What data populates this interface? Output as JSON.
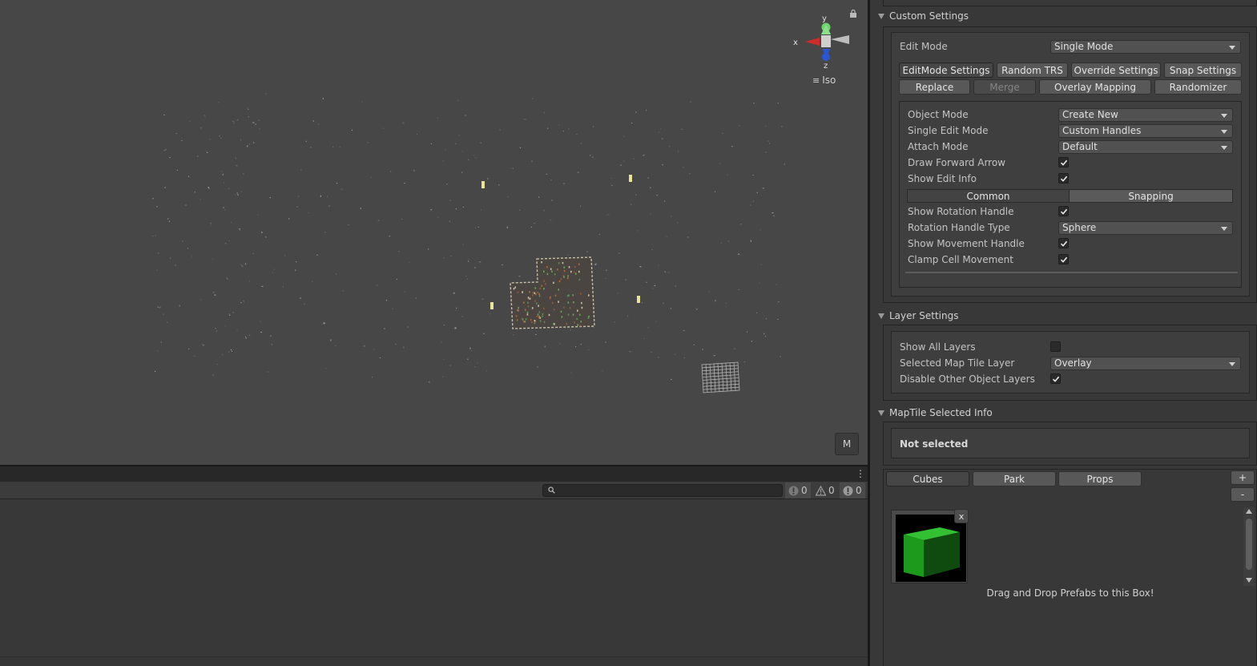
{
  "scene": {
    "gizmo_axes": {
      "y": "y",
      "x": "x",
      "z": "z"
    },
    "projection_label": "Iso",
    "m_button_label": "M"
  },
  "console": {
    "search_placeholder": "",
    "log_count": "0",
    "warning_count": "0",
    "error_count": "0"
  },
  "custom_settings": {
    "title": "Custom Settings",
    "edit_mode_label": "Edit Mode",
    "edit_mode_value": "Single Mode",
    "tabs_row1": [
      "EditMode Settings",
      "Random TRS",
      "Override Settings",
      "Snap Settings"
    ],
    "tabs_row2": [
      "Replace",
      "Merge",
      "Overlay Mapping",
      "Randomizer"
    ],
    "object_mode_label": "Object Mode",
    "object_mode_value": "Create New",
    "single_edit_mode_label": "Single Edit Mode",
    "single_edit_mode_value": "Custom Handles",
    "attach_mode_label": "Attach Mode",
    "attach_mode_value": "Default",
    "draw_forward_arrow_label": "Draw Forward Arrow",
    "draw_forward_arrow_checked": true,
    "show_edit_info_label": "Show Edit Info",
    "show_edit_info_checked": true,
    "segment_common": "Common",
    "segment_snapping": "Snapping",
    "show_rotation_handle_label": "Show Rotation Handle",
    "show_rotation_handle_checked": true,
    "rotation_handle_type_label": "Rotation Handle Type",
    "rotation_handle_type_value": "Sphere",
    "show_movement_handle_label": "Show Movement Handle",
    "show_movement_handle_checked": true,
    "clamp_cell_movement_label": "Clamp Cell Movement",
    "clamp_cell_movement_checked": true
  },
  "layer_settings": {
    "title": "Layer Settings",
    "show_all_layers_label": "Show All Layers",
    "show_all_layers_checked": false,
    "selected_map_tile_layer_label": "Selected Map Tile Layer",
    "selected_map_tile_layer_value": "Overlay",
    "disable_other_object_layers_label": "Disable Other Object Layers",
    "disable_other_object_layers_checked": true
  },
  "maptile_info": {
    "title": "MapTile Selected Info",
    "status": "Not selected"
  },
  "prefab_palette": {
    "tabs": [
      "Cubes",
      "Park",
      "Props"
    ],
    "add_label": "+",
    "remove_label": "-",
    "remove_item_label": "x",
    "drop_hint": "Drag and Drop Prefabs to this Box!"
  },
  "colors": {
    "scene_background": "#474747",
    "panel_background": "#383838",
    "accent_green": "#1f9a1f"
  }
}
